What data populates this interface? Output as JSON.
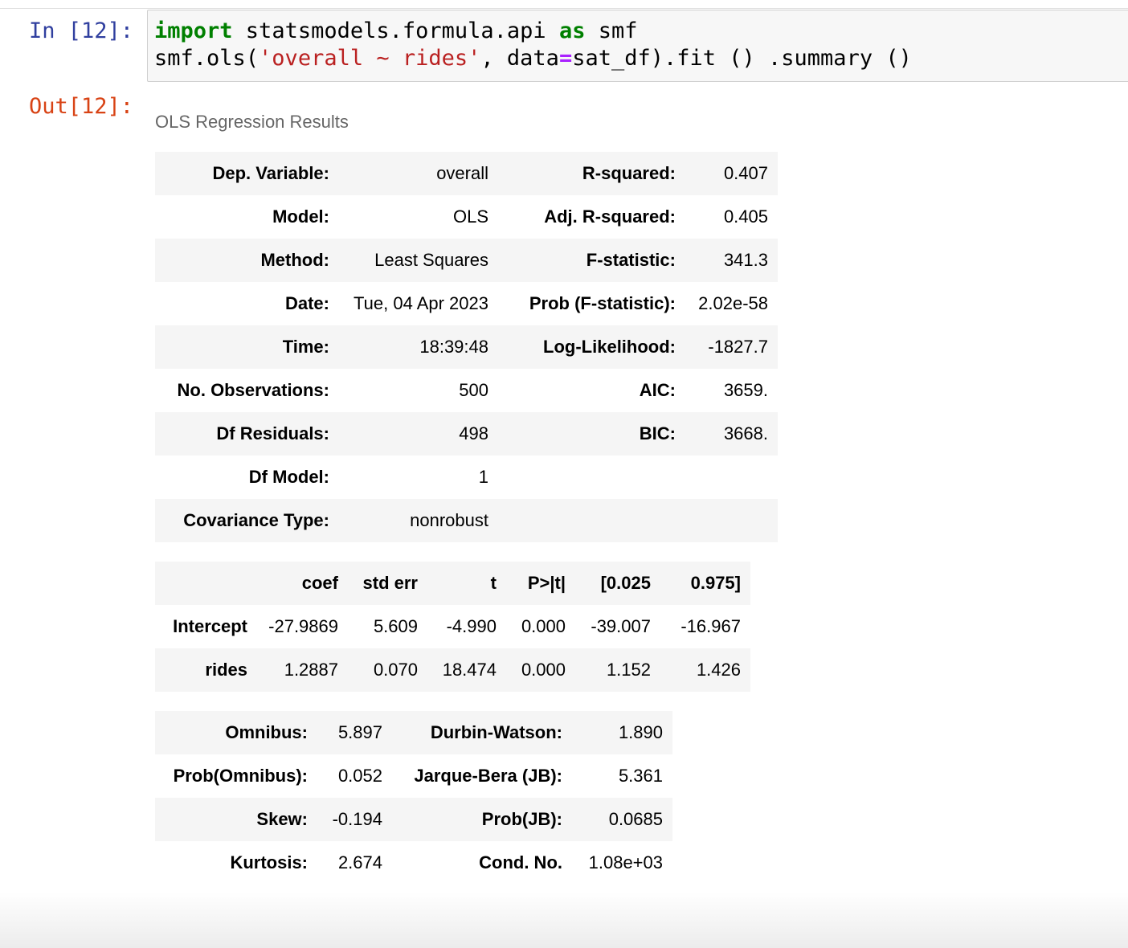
{
  "cell": {
    "in_prompt": "In [12]:",
    "out_prompt": "Out[12]:",
    "code": {
      "line1": {
        "kw_import": "import",
        "module": " statsmodels.formula.api ",
        "kw_as": "as",
        "alias": " smf"
      },
      "line2": {
        "call": "smf.ols(",
        "formula": "'overall ~ rides'",
        "sep": ", data",
        "eq": "=",
        "tail": "sat_df).fit () .summary ()"
      }
    }
  },
  "output": {
    "caption": "OLS Regression Results",
    "summary_table": [
      [
        "Dep. Variable:",
        "overall",
        "R-squared:",
        "0.407"
      ],
      [
        "Model:",
        "OLS",
        "Adj. R-squared:",
        "0.405"
      ],
      [
        "Method:",
        "Least Squares",
        "F-statistic:",
        "341.3"
      ],
      [
        "Date:",
        "Tue, 04 Apr 2023",
        "Prob (F-statistic):",
        "2.02e-58"
      ],
      [
        "Time:",
        "18:39:48",
        "Log-Likelihood:",
        "-1827.7"
      ],
      [
        "No. Observations:",
        "500",
        "AIC:",
        "3659."
      ],
      [
        "Df Residuals:",
        "498",
        "BIC:",
        "3668."
      ],
      [
        "Df Model:",
        "1",
        "",
        ""
      ],
      [
        "Covariance Type:",
        "nonrobust",
        "",
        ""
      ]
    ],
    "coef_table": {
      "headers": [
        "",
        "coef",
        "std err",
        "t",
        "P>|t|",
        "[0.025",
        "0.975]"
      ],
      "rows": [
        [
          "Intercept",
          "-27.9869",
          "5.609",
          "-4.990",
          "0.000",
          "-39.007",
          "-16.967"
        ],
        [
          "rides",
          "1.2887",
          "0.070",
          "18.474",
          "0.000",
          "1.152",
          "1.426"
        ]
      ]
    },
    "diag_table": [
      [
        "Omnibus:",
        "5.897",
        "Durbin-Watson:",
        "1.890"
      ],
      [
        "Prob(Omnibus):",
        "0.052",
        "Jarque-Bera (JB):",
        "5.361"
      ],
      [
        "Skew:",
        "-0.194",
        "Prob(JB):",
        "0.0685"
      ],
      [
        "Kurtosis:",
        "2.674",
        "Cond. No.",
        "1.08e+03"
      ]
    ]
  }
}
